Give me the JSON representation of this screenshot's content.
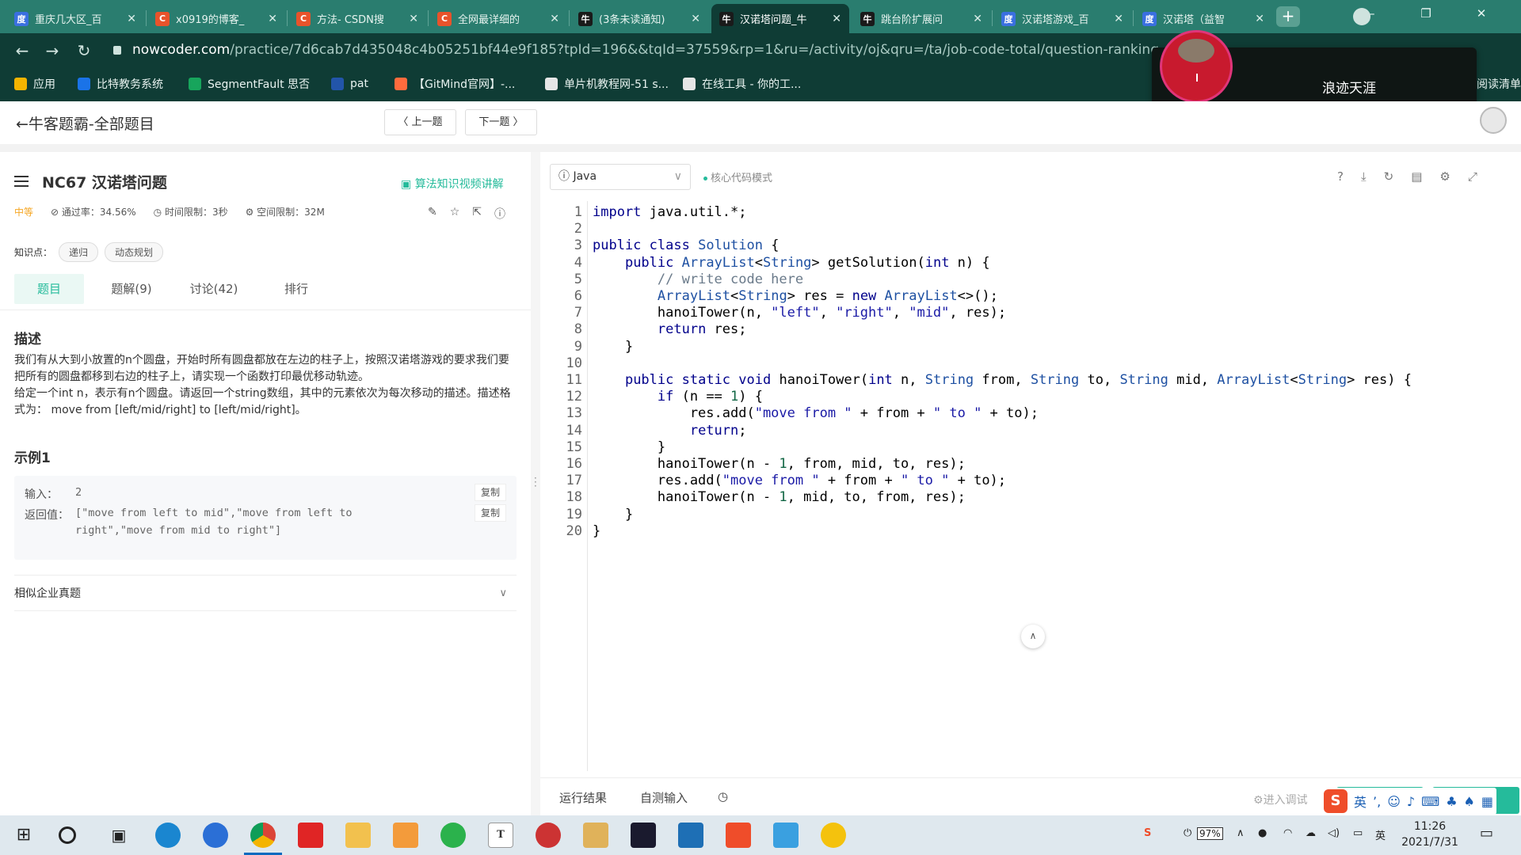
{
  "browser": {
    "tabs": [
      {
        "title": "重庆几大区_百",
        "fav_color": "#3a6fe0",
        "fav_glyph": "度",
        "icon": "baidu-icon"
      },
      {
        "title": "x0919的博客_",
        "fav_color": "#e8532b",
        "fav_glyph": "C",
        "icon": "csdn-icon"
      },
      {
        "title": "方法- CSDN搜",
        "fav_color": "#e8532b",
        "fav_glyph": "C",
        "icon": "csdn-icon"
      },
      {
        "title": "全网最详细的",
        "fav_color": "#e8532b",
        "fav_glyph": "C",
        "icon": "csdn-icon"
      },
      {
        "title": "(3条未读通知)",
        "fav_color": "#1a1a1a",
        "fav_glyph": "牛",
        "icon": "nowcoder-icon"
      },
      {
        "title": "汉诺塔问题_牛",
        "fav_color": "#1a1a1a",
        "fav_glyph": "牛",
        "icon": "nowcoder-icon",
        "active": true
      },
      {
        "title": "跳台阶扩展问",
        "fav_color": "#1a1a1a",
        "fav_glyph": "牛",
        "icon": "nowcoder-icon"
      },
      {
        "title": "汉诺塔游戏_百",
        "fav_color": "#3a6fe0",
        "fav_glyph": "度",
        "icon": "baidu-icon"
      },
      {
        "title": "汉诺塔（益智",
        "fav_color": "#3a6fe0",
        "fav_glyph": "度",
        "icon": "baidu-icon"
      }
    ],
    "url_host": "nowcoder.com",
    "url_path": "/practice/7d6cab7d435048c4b05251bf44e9f185?tpId=196&&tqId=37559&rp=1&ru=/activity/oj&qru=/ta/job-code-total/question-ranking",
    "bookmarks": [
      {
        "label": "应用",
        "icon": "apps-grid-icon"
      },
      {
        "label": "比特教务系统",
        "icon": "bitedu-icon"
      },
      {
        "label": "SegmentFault 思否",
        "icon": "segmentfault-icon"
      },
      {
        "label": "pat",
        "icon": "pat-icon"
      },
      {
        "label": "【GitMind官网】-...",
        "icon": "gitmind-icon"
      },
      {
        "label": "单片机教程网-51 s...",
        "icon": "globe-icon"
      },
      {
        "label": "在线工具 - 你的工...",
        "icon": "tools-icon"
      }
    ],
    "bookmarks_more": "阅读清单"
  },
  "popup": {
    "name": "浪迹天涯"
  },
  "header": {
    "back_label": "←牛客题霸-全部题目",
    "prev_label": "〈 上一题",
    "next_label": "下一题 〉"
  },
  "problem": {
    "id_title": "NC67  汉诺塔问题",
    "video_link": "算法知识视频讲解",
    "difficulty": "中等",
    "pass_rate": "通过率：34.56%",
    "time_limit": "时间限制：3秒",
    "space_limit": "空间限制：32M",
    "knowledge_label": "知识点：",
    "tags": [
      "递归",
      "动态规划"
    ],
    "tabs": [
      "题目",
      "题解(9)",
      "讨论(42)",
      "排行"
    ],
    "desc_title": "描述",
    "desc_p1": "我们有从大到小放置的n个圆盘，开始时所有圆盘都放在左边的柱子上，按照汉诺塔游戏的要求我们要把所有的圆盘都移到右边的柱子上，请实现一个函数打印最优移动轨迹。",
    "desc_p2": "给定一个int n，表示有n个圆盘。请返回一个string数组，其中的元素依次为每次移动的描述。描述格式为： move from [left/mid/right] to [left/mid/right]。",
    "example_title": "示例1",
    "input_label": "输入：",
    "input_value": "2",
    "output_label": "返回值：",
    "output_value": "[\"move from left to mid\",\"move from left to right\",\"move from mid to right\"]",
    "copy_label": "复制",
    "similar_label": "相似企业真题"
  },
  "editor": {
    "language": "Java",
    "mode_label": "核心代码模式",
    "line_numbers": [
      "1",
      "2",
      "3",
      "4",
      "5",
      "6",
      "7",
      "8",
      "9",
      "10",
      "11",
      "12",
      "13",
      "14",
      "15",
      "16",
      "17",
      "18",
      "19",
      "20"
    ],
    "code_lines": [
      "import java.util.*;",
      "",
      "public class Solution {",
      "    public ArrayList<String> getSolution(int n) {",
      "        // write code here",
      "        ArrayList<String> res = new ArrayList<>();",
      "        hanoiTower(n, \"left\", \"right\", \"mid\", res);",
      "        return res;",
      "    }",
      "",
      "    public static void hanoiTower(int n, String from, String to, String mid, ArrayList<String> res) {",
      "        if (n == 1) {",
      "            res.add(\"move from \" + from + \" to \" + to);",
      "            return;",
      "        }",
      "        hanoiTower(n - 1, from, mid, to, res);",
      "        res.add(\"move from \" + from + \" to \" + to);",
      "        hanoiTower(n - 1, mid, to, from, res);",
      "    }",
      "}"
    ],
    "bottom_tabs": [
      "运行结果",
      "自测输入"
    ],
    "debug_label": "进入调试"
  },
  "taskbar": {
    "battery": "97%",
    "ime_lang": "英",
    "time": "11:26",
    "date": "2021/7/31"
  },
  "colors": {
    "accent": "#25bb9b",
    "chrome_dark": "#0f3c35",
    "chrome_tab": "#2a7d6f"
  }
}
